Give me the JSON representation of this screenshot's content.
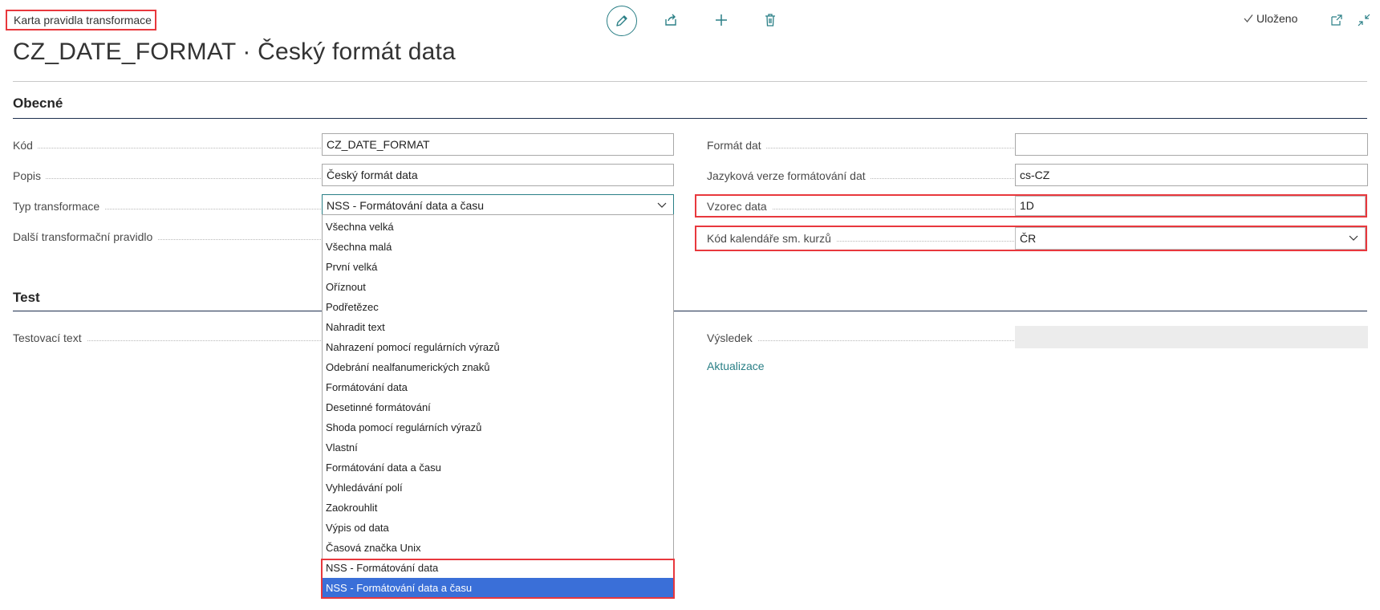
{
  "header": {
    "breadcrumb": "Karta pravidla transformace",
    "title": "CZ_DATE_FORMAT · Český formát data",
    "saved_status": "Uloženo"
  },
  "toolbar": {
    "icons": [
      "pencil-icon",
      "share-icon",
      "plus-icon",
      "trash-icon",
      "open-new-window-icon",
      "collapse-icon"
    ]
  },
  "general": {
    "section_title": "Obecné",
    "code_label": "Kód",
    "code_value": "CZ_DATE_FORMAT",
    "description_label": "Popis",
    "description_value": "Český formát data",
    "transformation_type_label": "Typ transformace",
    "transformation_type_value": "NSS - Formátování data a času",
    "next_rule_label": "Další transformační pravidlo",
    "data_format_label": "Formát dat",
    "data_format_value": "",
    "data_format_language_label": "Jazyková verze formátování dat",
    "data_format_language_value": "cs-CZ",
    "date_formula_label": "Vzorec data",
    "date_formula_value": "1D",
    "exchange_calendar_label": "Kód kalendáře sm. kurzů",
    "exchange_calendar_value": "ČR"
  },
  "dropdown": {
    "options": [
      "Všechna velká",
      "Všechna malá",
      "První velká",
      "Oříznout",
      "Podřetězec",
      "Nahradit text",
      "Nahrazení pomocí regulárních výrazů",
      "Odebrání nealfanumerických znaků",
      "Formátování data",
      "Desetinné formátování",
      "Shoda pomocí regulárních výrazů",
      "Vlastní",
      "Formátování data a času",
      "Vyhledávání polí",
      "Zaokrouhlit",
      "Výpis od data",
      "Časová značka Unix",
      "NSS - Formátování data",
      "NSS - Formátování data a času"
    ],
    "selected": "NSS - Formátování data a času"
  },
  "test": {
    "section_title": "Test",
    "test_text_label": "Testovací text",
    "result_label": "Výsledek",
    "result_value": "",
    "refresh_link": "Aktualizace"
  },
  "colors": {
    "accent": "#2a7f86",
    "highlight": "#e8383d",
    "selection": "#3a6fd8"
  }
}
